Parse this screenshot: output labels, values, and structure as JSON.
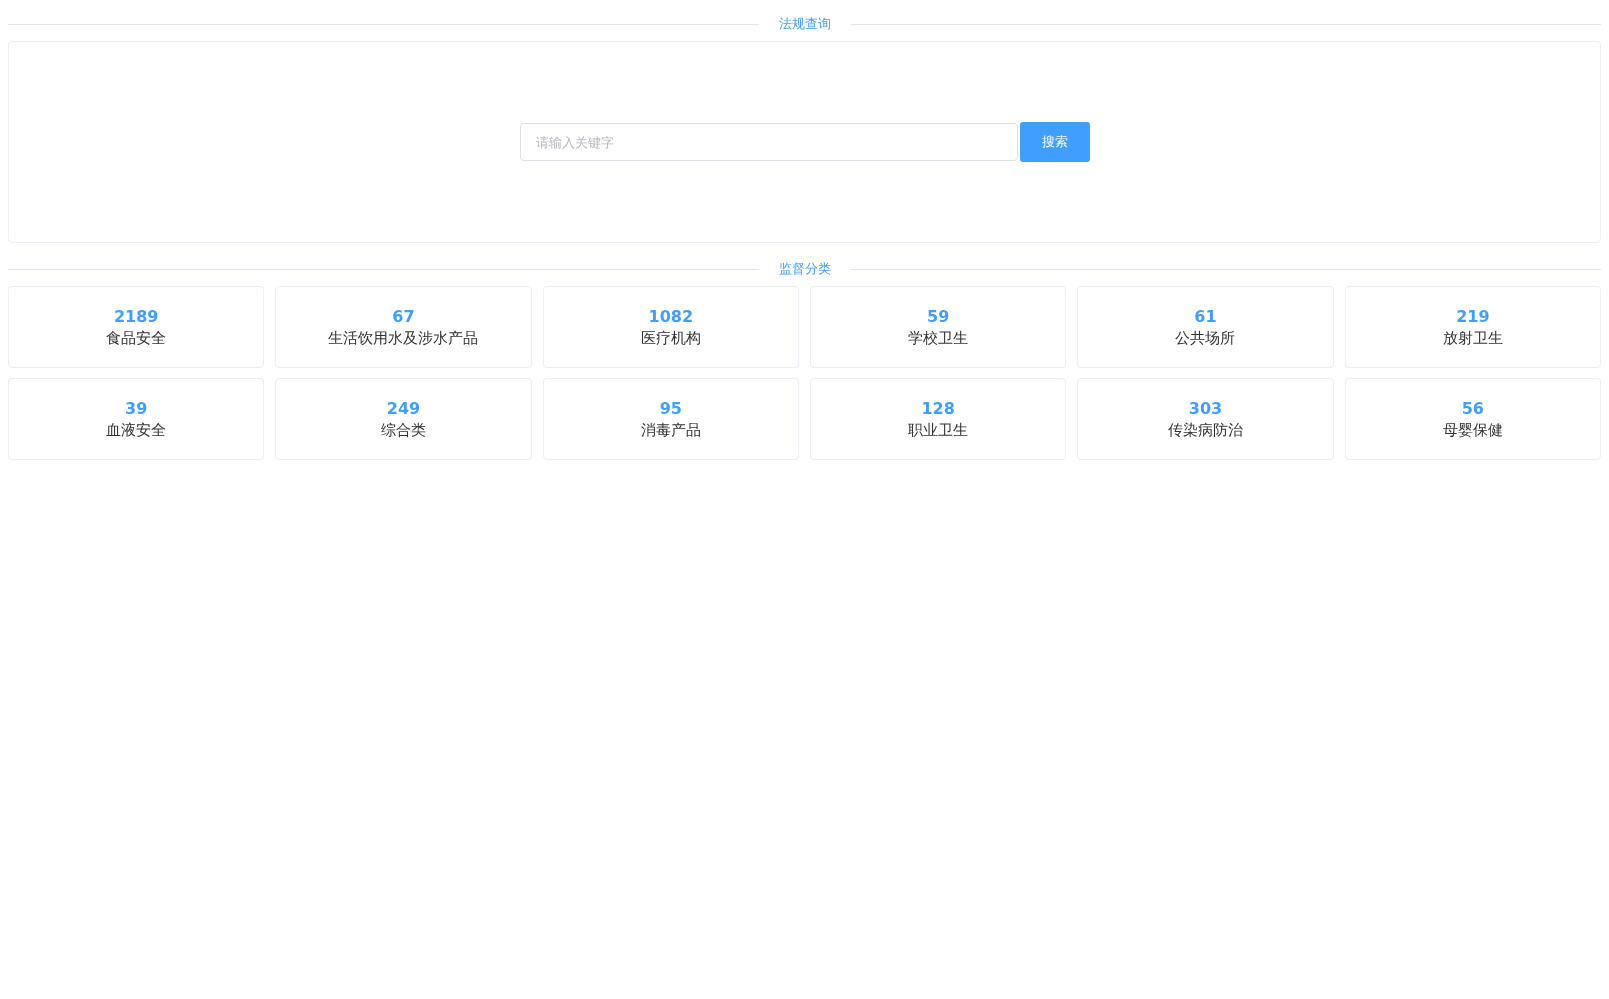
{
  "search_section": {
    "title": "法规查询",
    "placeholder": "请输入关键字",
    "button": "搜索"
  },
  "category_section": {
    "title": "监督分类",
    "categories": [
      {
        "count": "2189",
        "label": "食品安全"
      },
      {
        "count": "67",
        "label": "生活饮用水及涉水产品"
      },
      {
        "count": "1082",
        "label": "医疗机构"
      },
      {
        "count": "59",
        "label": "学校卫生"
      },
      {
        "count": "61",
        "label": "公共场所"
      },
      {
        "count": "219",
        "label": "放射卫生"
      },
      {
        "count": "39",
        "label": "血液安全"
      },
      {
        "count": "249",
        "label": "综合类"
      },
      {
        "count": "95",
        "label": "消毒产品"
      },
      {
        "count": "128",
        "label": "职业卫生"
      },
      {
        "count": "303",
        "label": "传染病防治"
      },
      {
        "count": "56",
        "label": "母婴保健"
      }
    ]
  }
}
